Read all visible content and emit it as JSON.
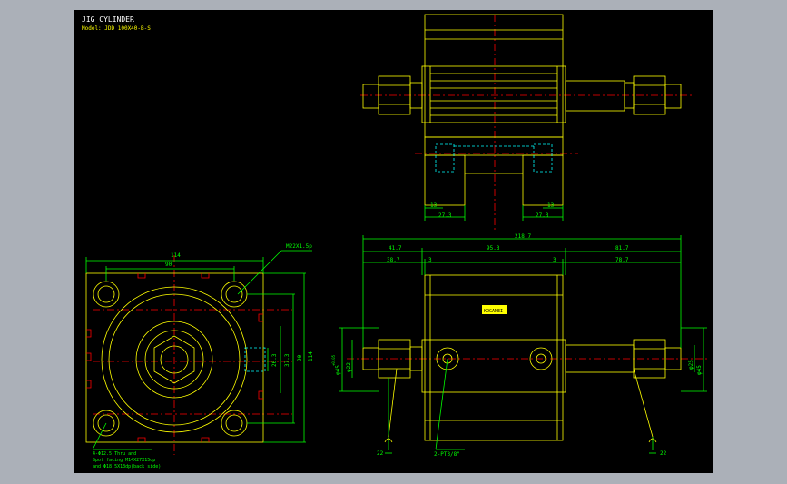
{
  "title": "JIG CYLINDER",
  "model": "Model: JDD 100X40-B-S",
  "dimensions": {
    "top_left_13": "13",
    "top_right_13": "13",
    "top_left_27": "27.3",
    "top_right_27": "27.3",
    "overall": "218.7",
    "d41": "41.7",
    "d95": "95.3",
    "d81": "81.7",
    "d38": "38.7",
    "d3a": "3",
    "d3b": "3",
    "d78": "78.7",
    "w114": "114",
    "w90": "90",
    "h114": "114",
    "h90": "90",
    "h37": "37.3",
    "h26": "26.3",
    "thread": "M22X1.5p",
    "phi45": "φ45",
    "phi25": "φ25",
    "phi45r": "φ45",
    "v22a": "22",
    "v22b": "22",
    "port": "2-PT3/8\"",
    "tol": "+0.05",
    "phi22": "φ22"
  },
  "notes": {
    "line1": "4-Φ12.5 Thru and",
    "line2": "Spot facing M14X27X15dp",
    "line3": "and Φ18.5X13dp(back side)"
  },
  "badge": "KOGANEI",
  "colors": {
    "background": "#000000",
    "frame": "#abb0b8",
    "outline": "#ffff00",
    "dimension": "#00ff00",
    "centerline": "#ff0000",
    "hidden": "#00ffff",
    "white": "#ffffff"
  }
}
